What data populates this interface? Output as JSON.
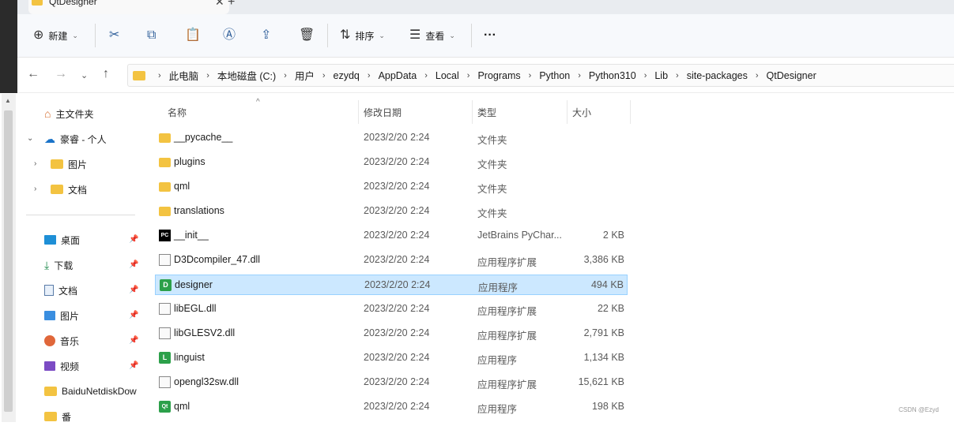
{
  "tab": {
    "title": "QtDesigner",
    "close": "✕",
    "new": "+"
  },
  "toolbar": {
    "new_label": "新建",
    "sort_label": "排序",
    "view_label": "查看",
    "more_label": "···"
  },
  "address": {
    "crumbs": [
      "此电脑",
      "本地磁盘 (C:)",
      "用户",
      "ezydq",
      "AppData",
      "Local",
      "Programs",
      "Python",
      "Python310",
      "Lib",
      "site-packages",
      "QtDesigner"
    ]
  },
  "nav": {
    "home": "主文件夹",
    "onedrive": "豪睿 - 个人",
    "od_pictures": "图片",
    "od_documents": "文档",
    "desktop": "桌面",
    "downloads": "下载",
    "documents": "文档",
    "pictures": "图片",
    "music": "音乐",
    "videos": "视频",
    "baidu": "BaiduNetdiskDow",
    "partial": "番"
  },
  "columns": {
    "name": "名称",
    "date": "修改日期",
    "type": "类型",
    "size": "大小"
  },
  "files": [
    {
      "name": "__pycache__",
      "date": "2023/2/20 2:24",
      "type": "文件夹",
      "size": "",
      "icon": "folder-icon"
    },
    {
      "name": "plugins",
      "date": "2023/2/20 2:24",
      "type": "文件夹",
      "size": "",
      "icon": "folder-icon"
    },
    {
      "name": "qml",
      "date": "2023/2/20 2:24",
      "type": "文件夹",
      "size": "",
      "icon": "folder-icon"
    },
    {
      "name": "translations",
      "date": "2023/2/20 2:24",
      "type": "文件夹",
      "size": "",
      "icon": "folder-icon"
    },
    {
      "name": "__init__",
      "date": "2023/2/20 2:24",
      "type": "JetBrains PyChar...",
      "size": "2 KB",
      "icon": "pycharm-icon"
    },
    {
      "name": "D3Dcompiler_47.dll",
      "date": "2023/2/20 2:24",
      "type": "应用程序扩展",
      "size": "3,386 KB",
      "icon": "dll-icon"
    },
    {
      "name": "designer",
      "date": "2023/2/20 2:24",
      "type": "应用程序",
      "size": "494 KB",
      "icon": "designer-app-icon"
    },
    {
      "name": "libEGL.dll",
      "date": "2023/2/20 2:24",
      "type": "应用程序扩展",
      "size": "22 KB",
      "icon": "dll-icon"
    },
    {
      "name": "libGLESV2.dll",
      "date": "2023/2/20 2:24",
      "type": "应用程序扩展",
      "size": "2,791 KB",
      "icon": "dll-icon"
    },
    {
      "name": "linguist",
      "date": "2023/2/20 2:24",
      "type": "应用程序",
      "size": "1,134 KB",
      "icon": "linguist-app-icon"
    },
    {
      "name": "opengl32sw.dll",
      "date": "2023/2/20 2:24",
      "type": "应用程序扩展",
      "size": "15,621 KB",
      "icon": "dll-icon"
    },
    {
      "name": "qml",
      "date": "2023/2/20 2:24",
      "type": "应用程序",
      "size": "198 KB",
      "icon": "qt-app-icon"
    }
  ],
  "watermark": "CSDN @Ezyd",
  "colors": {
    "selection": "#cce8ff",
    "folder": "#f3c341",
    "app_green": "#2ca04a"
  }
}
